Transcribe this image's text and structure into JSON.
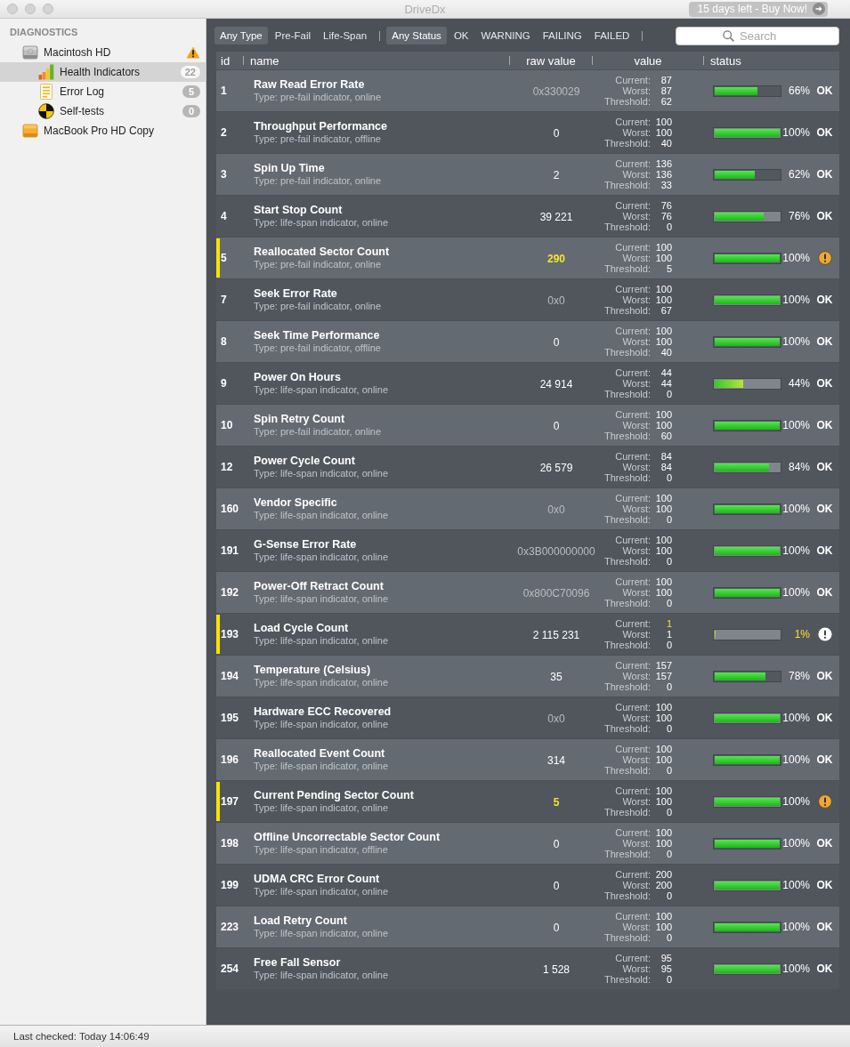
{
  "window": {
    "title": "DriveDx",
    "trial_button": "15 days left - Buy Now!"
  },
  "sidebar": {
    "section": "DIAGNOSTICS",
    "items": [
      {
        "kind": "internal-disk",
        "label": "Macintosh HD",
        "selected": false,
        "alert": true,
        "children": [
          {
            "kind": "health",
            "label": "Health Indicators",
            "selected": true,
            "badge": "22"
          },
          {
            "kind": "log",
            "label": "Error Log",
            "selected": false,
            "badge": "5"
          },
          {
            "kind": "selftest",
            "label": "Self-tests",
            "selected": false,
            "badge": "0"
          }
        ]
      },
      {
        "kind": "external-disk",
        "label": "MacBook Pro HD Copy",
        "selected": false,
        "alert": false
      }
    ]
  },
  "filters": {
    "type": [
      {
        "label": "Any Type",
        "selected": true
      },
      {
        "label": "Pre-Fail",
        "selected": false
      },
      {
        "label": "Life-Span",
        "selected": false
      }
    ],
    "status": [
      {
        "label": "Any Status",
        "selected": true
      },
      {
        "label": "OK",
        "selected": false
      },
      {
        "label": "WARNING",
        "selected": false
      },
      {
        "label": "FAILING",
        "selected": false
      },
      {
        "label": "FAILED",
        "selected": false
      }
    ]
  },
  "search": {
    "placeholder": "Search"
  },
  "table": {
    "columns": [
      "id",
      "name",
      "raw value",
      "value",
      "status"
    ],
    "rows": [
      {
        "id": "1",
        "name": "Raw Read Error Rate",
        "type": "Type: pre-fail indicator, online",
        "flagged": false,
        "raw": "0x330029",
        "raw_dim": true,
        "raw_warn": false,
        "values": [
          {
            "label": "Current:",
            "value": "87",
            "warn": false
          },
          {
            "label": "Worst:",
            "value": "87",
            "warn": false
          },
          {
            "label": "Threshold:",
            "value": "62",
            "warn": false
          }
        ],
        "level": 0.66,
        "percent": "66%",
        "percent_warn": false,
        "status": {
          "kind": "ok",
          "label": "OK"
        }
      },
      {
        "id": "2",
        "name": "Throughput Performance",
        "type": "Type: pre-fail indicator, offline",
        "flagged": false,
        "raw": "0",
        "raw_dim": false,
        "raw_warn": false,
        "values": [
          {
            "label": "Current:",
            "value": "100",
            "warn": false
          },
          {
            "label": "Worst:",
            "value": "100",
            "warn": false
          },
          {
            "label": "Threshold:",
            "value": "40",
            "warn": false
          }
        ],
        "level": 1,
        "percent": "100%",
        "percent_warn": false,
        "status": {
          "kind": "ok",
          "label": "OK"
        }
      },
      {
        "id": "3",
        "name": "Spin Up Time",
        "type": "Type: pre-fail indicator, online",
        "flagged": false,
        "raw": "2",
        "raw_dim": false,
        "raw_warn": false,
        "values": [
          {
            "label": "Current:",
            "value": "136",
            "warn": false
          },
          {
            "label": "Worst:",
            "value": "136",
            "warn": false
          },
          {
            "label": "Threshold:",
            "value": "33",
            "warn": false
          }
        ],
        "level": 0.62,
        "percent": "62%",
        "percent_warn": false,
        "status": {
          "kind": "ok",
          "label": "OK"
        }
      },
      {
        "id": "4",
        "name": "Start Stop Count",
        "type": "Type: life-span indicator, online",
        "flagged": false,
        "raw": "39 221",
        "raw_dim": false,
        "raw_warn": false,
        "values": [
          {
            "label": "Current:",
            "value": "76",
            "warn": false
          },
          {
            "label": "Worst:",
            "value": "76",
            "warn": false
          },
          {
            "label": "Threshold:",
            "value": "0",
            "warn": false
          }
        ],
        "level": 0.76,
        "percent": "76%",
        "percent_warn": false,
        "status": {
          "kind": "ok",
          "label": "OK"
        }
      },
      {
        "id": "5",
        "name": "Reallocated Sector Count",
        "type": "Type: pre-fail indicator, online",
        "flagged": true,
        "raw": "290",
        "raw_dim": false,
        "raw_warn": true,
        "values": [
          {
            "label": "Current:",
            "value": "100",
            "warn": false
          },
          {
            "label": "Worst:",
            "value": "100",
            "warn": false
          },
          {
            "label": "Threshold:",
            "value": "5",
            "warn": false
          }
        ],
        "level": 1,
        "percent": "100%",
        "percent_warn": false,
        "status": {
          "kind": "warning"
        }
      },
      {
        "id": "7",
        "name": "Seek Error Rate",
        "type": "Type: pre-fail indicator, online",
        "flagged": false,
        "raw": "0x0",
        "raw_dim": true,
        "raw_warn": false,
        "values": [
          {
            "label": "Current:",
            "value": "100",
            "warn": false
          },
          {
            "label": "Worst:",
            "value": "100",
            "warn": false
          },
          {
            "label": "Threshold:",
            "value": "67",
            "warn": false
          }
        ],
        "level": 1,
        "percent": "100%",
        "percent_warn": false,
        "status": {
          "kind": "ok",
          "label": "OK"
        }
      },
      {
        "id": "8",
        "name": "Seek Time Performance",
        "type": "Type: pre-fail indicator, offline",
        "flagged": false,
        "raw": "0",
        "raw_dim": false,
        "raw_warn": false,
        "values": [
          {
            "label": "Current:",
            "value": "100",
            "warn": false
          },
          {
            "label": "Worst:",
            "value": "100",
            "warn": false
          },
          {
            "label": "Threshold:",
            "value": "40",
            "warn": false
          }
        ],
        "level": 1,
        "percent": "100%",
        "percent_warn": false,
        "status": {
          "kind": "ok",
          "label": "OK"
        }
      },
      {
        "id": "9",
        "name": "Power On Hours",
        "type": "Type: life-span indicator, online",
        "flagged": false,
        "raw": "24 914",
        "raw_dim": false,
        "raw_warn": false,
        "values": [
          {
            "label": "Current:",
            "value": "44",
            "warn": false
          },
          {
            "label": "Worst:",
            "value": "44",
            "warn": false
          },
          {
            "label": "Threshold:",
            "value": "0",
            "warn": false
          }
        ],
        "level": 0.44,
        "percent": "44%",
        "percent_warn": false,
        "status": {
          "kind": "ok",
          "label": "OK"
        }
      },
      {
        "id": "10",
        "name": "Spin Retry Count",
        "type": "Type: pre-fail indicator, online",
        "flagged": false,
        "raw": "0",
        "raw_dim": false,
        "raw_warn": false,
        "values": [
          {
            "label": "Current:",
            "value": "100",
            "warn": false
          },
          {
            "label": "Worst:",
            "value": "100",
            "warn": false
          },
          {
            "label": "Threshold:",
            "value": "60",
            "warn": false
          }
        ],
        "level": 1,
        "percent": "100%",
        "percent_warn": false,
        "status": {
          "kind": "ok",
          "label": "OK"
        }
      },
      {
        "id": "12",
        "name": "Power Cycle Count",
        "type": "Type: life-span indicator, online",
        "flagged": false,
        "raw": "26 579",
        "raw_dim": false,
        "raw_warn": false,
        "values": [
          {
            "label": "Current:",
            "value": "84",
            "warn": false
          },
          {
            "label": "Worst:",
            "value": "84",
            "warn": false
          },
          {
            "label": "Threshold:",
            "value": "0",
            "warn": false
          }
        ],
        "level": 0.84,
        "percent": "84%",
        "percent_warn": false,
        "status": {
          "kind": "ok",
          "label": "OK"
        }
      },
      {
        "id": "160",
        "name": "Vendor Specific",
        "type": "Type: life-span indicator, online",
        "flagged": false,
        "raw": "0x0",
        "raw_dim": true,
        "raw_warn": false,
        "values": [
          {
            "label": "Current:",
            "value": "100",
            "warn": false
          },
          {
            "label": "Worst:",
            "value": "100",
            "warn": false
          },
          {
            "label": "Threshold:",
            "value": "0",
            "warn": false
          }
        ],
        "level": 1,
        "percent": "100%",
        "percent_warn": false,
        "status": {
          "kind": "ok",
          "label": "OK"
        }
      },
      {
        "id": "191",
        "name": "G-Sense Error Rate",
        "type": "Type: life-span indicator, online",
        "flagged": false,
        "raw": "0x3B000000000",
        "raw_dim": true,
        "raw_warn": false,
        "values": [
          {
            "label": "Current:",
            "value": "100",
            "warn": false
          },
          {
            "label": "Worst:",
            "value": "100",
            "warn": false
          },
          {
            "label": "Threshold:",
            "value": "0",
            "warn": false
          }
        ],
        "level": 1,
        "percent": "100%",
        "percent_warn": false,
        "status": {
          "kind": "ok",
          "label": "OK"
        }
      },
      {
        "id": "192",
        "name": "Power-Off Retract Count",
        "type": "Type: life-span indicator, online",
        "flagged": false,
        "raw": "0x800C70096",
        "raw_dim": true,
        "raw_warn": false,
        "values": [
          {
            "label": "Current:",
            "value": "100",
            "warn": false
          },
          {
            "label": "Worst:",
            "value": "100",
            "warn": false
          },
          {
            "label": "Threshold:",
            "value": "0",
            "warn": false
          }
        ],
        "level": 1,
        "percent": "100%",
        "percent_warn": false,
        "status": {
          "kind": "ok",
          "label": "OK"
        }
      },
      {
        "id": "193",
        "name": "Load Cycle Count",
        "type": "Type: life-span indicator, online",
        "flagged": true,
        "raw": "2 115 231",
        "raw_dim": false,
        "raw_warn": false,
        "values": [
          {
            "label": "Current:",
            "value": "1",
            "warn": true
          },
          {
            "label": "Worst:",
            "value": "1",
            "warn": false
          },
          {
            "label": "Threshold:",
            "value": "0",
            "warn": false
          }
        ],
        "level": 0.01,
        "percent": "1%",
        "percent_warn": true,
        "status": {
          "kind": "critical"
        }
      },
      {
        "id": "194",
        "name": "Temperature (Celsius)",
        "type": "Type: life-span indicator, online",
        "flagged": false,
        "raw": "35",
        "raw_dim": false,
        "raw_warn": false,
        "values": [
          {
            "label": "Current:",
            "value": "157",
            "warn": false
          },
          {
            "label": "Worst:",
            "value": "157",
            "warn": false
          },
          {
            "label": "Threshold:",
            "value": "0",
            "warn": false
          }
        ],
        "level": 0.78,
        "percent": "78%",
        "percent_warn": false,
        "status": {
          "kind": "ok",
          "label": "OK"
        }
      },
      {
        "id": "195",
        "name": "Hardware ECC Recovered",
        "type": "Type: life-span indicator, online",
        "flagged": false,
        "raw": "0x0",
        "raw_dim": true,
        "raw_warn": false,
        "values": [
          {
            "label": "Current:",
            "value": "100",
            "warn": false
          },
          {
            "label": "Worst:",
            "value": "100",
            "warn": false
          },
          {
            "label": "Threshold:",
            "value": "0",
            "warn": false
          }
        ],
        "level": 1,
        "percent": "100%",
        "percent_warn": false,
        "status": {
          "kind": "ok",
          "label": "OK"
        }
      },
      {
        "id": "196",
        "name": "Reallocated Event Count",
        "type": "Type: life-span indicator, online",
        "flagged": false,
        "raw": "314",
        "raw_dim": false,
        "raw_warn": false,
        "values": [
          {
            "label": "Current:",
            "value": "100",
            "warn": false
          },
          {
            "label": "Worst:",
            "value": "100",
            "warn": false
          },
          {
            "label": "Threshold:",
            "value": "0",
            "warn": false
          }
        ],
        "level": 1,
        "percent": "100%",
        "percent_warn": false,
        "status": {
          "kind": "ok",
          "label": "OK"
        }
      },
      {
        "id": "197",
        "name": "Current Pending Sector Count",
        "type": "Type: life-span indicator, online",
        "flagged": true,
        "raw": "5",
        "raw_dim": false,
        "raw_warn": true,
        "values": [
          {
            "label": "Current:",
            "value": "100",
            "warn": false
          },
          {
            "label": "Worst:",
            "value": "100",
            "warn": false
          },
          {
            "label": "Threshold:",
            "value": "0",
            "warn": false
          }
        ],
        "level": 1,
        "percent": "100%",
        "percent_warn": false,
        "status": {
          "kind": "warning"
        }
      },
      {
        "id": "198",
        "name": "Offline Uncorrectable Sector Count",
        "type": "Type: life-span indicator, offline",
        "flagged": false,
        "raw": "0",
        "raw_dim": false,
        "raw_warn": false,
        "values": [
          {
            "label": "Current:",
            "value": "100",
            "warn": false
          },
          {
            "label": "Worst:",
            "value": "100",
            "warn": false
          },
          {
            "label": "Threshold:",
            "value": "0",
            "warn": false
          }
        ],
        "level": 1,
        "percent": "100%",
        "percent_warn": false,
        "status": {
          "kind": "ok",
          "label": "OK"
        }
      },
      {
        "id": "199",
        "name": "UDMA CRC Error Count",
        "type": "Type: life-span indicator, online",
        "flagged": false,
        "raw": "0",
        "raw_dim": false,
        "raw_warn": false,
        "values": [
          {
            "label": "Current:",
            "value": "200",
            "warn": false
          },
          {
            "label": "Worst:",
            "value": "200",
            "warn": false
          },
          {
            "label": "Threshold:",
            "value": "0",
            "warn": false
          }
        ],
        "level": 1,
        "percent": "100%",
        "percent_warn": false,
        "status": {
          "kind": "ok",
          "label": "OK"
        }
      },
      {
        "id": "223",
        "name": "Load Retry Count",
        "type": "Type: life-span indicator, online",
        "flagged": false,
        "raw": "0",
        "raw_dim": false,
        "raw_warn": false,
        "values": [
          {
            "label": "Current:",
            "value": "100",
            "warn": false
          },
          {
            "label": "Worst:",
            "value": "100",
            "warn": false
          },
          {
            "label": "Threshold:",
            "value": "0",
            "warn": false
          }
        ],
        "level": 1,
        "percent": "100%",
        "percent_warn": false,
        "status": {
          "kind": "ok",
          "label": "OK"
        }
      },
      {
        "id": "254",
        "name": "Free Fall Sensor",
        "type": "Type: life-span indicator, online",
        "flagged": false,
        "raw": "1 528",
        "raw_dim": false,
        "raw_warn": false,
        "values": [
          {
            "label": "Current:",
            "value": "95",
            "warn": false
          },
          {
            "label": "Worst:",
            "value": "95",
            "warn": false
          },
          {
            "label": "Threshold:",
            "value": "0",
            "warn": false
          }
        ],
        "level": 1,
        "percent": "100%",
        "percent_warn": false,
        "status": {
          "kind": "ok",
          "label": "OK"
        }
      }
    ]
  },
  "status_bar": {
    "text": "Last checked: Today 14:06:49"
  }
}
